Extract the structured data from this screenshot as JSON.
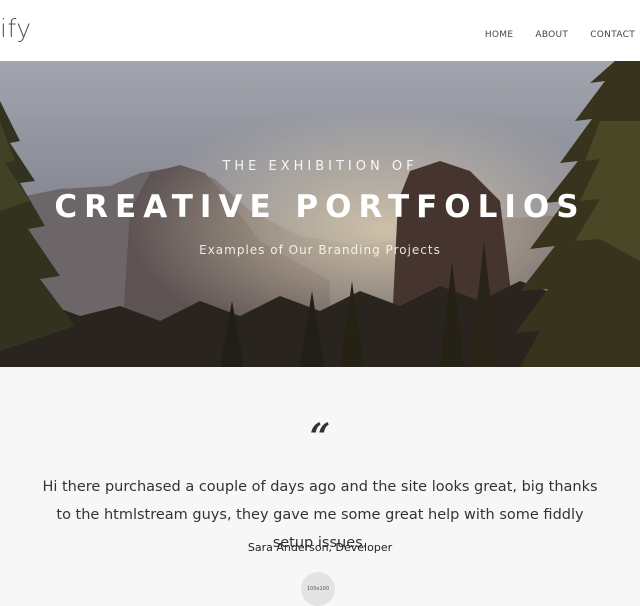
{
  "header": {
    "logo": "ify",
    "nav": [
      {
        "label": "HOME"
      },
      {
        "label": "ABOUT"
      },
      {
        "label": "CONTACT"
      }
    ]
  },
  "hero": {
    "pretitle": "THE EXHIBITION OF",
    "title": "CREATIVE PORTFOLIOS",
    "subtitle": "Examples of Our Branding Projects"
  },
  "testimonial": {
    "quote_mark": "“",
    "text": "Hi there purchased a couple of days ago and the site looks great, big thanks to the htmlstream guys, they gave me some great help with some fiddly setup issues.",
    "author": "Sara Anderson, Developer",
    "avatar_label": "100x100"
  },
  "colors": {
    "header_bg": "#ffffff",
    "section_bg": "#f7f7f7",
    "text": "#333333"
  }
}
